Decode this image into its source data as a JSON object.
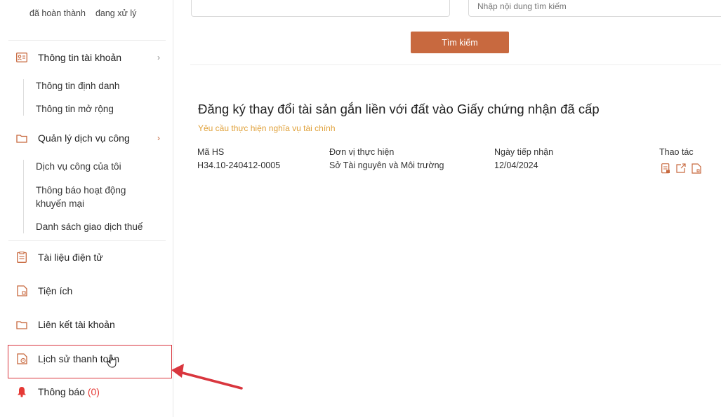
{
  "sidebar": {
    "status_tabs": [
      "đã hoàn thành",
      "đang xử lý"
    ],
    "account": {
      "label": "Thông tin tài khoản",
      "children": [
        "Thông tin định danh",
        "Thông tin mở rộng"
      ]
    },
    "services": {
      "label": "Quản lý dịch vụ công",
      "children": [
        "Dịch vụ công của tôi",
        "Thông báo hoạt động khuyến mại",
        "Danh sách giao dịch thuế"
      ]
    },
    "items": [
      {
        "label": "Tài liệu điện tử",
        "icon": "document-icon"
      },
      {
        "label": "Tiện ích",
        "icon": "utility-icon"
      },
      {
        "label": "Liên kết tài khoản",
        "icon": "folder-link-icon"
      },
      {
        "label": "Lịch sử thanh toán",
        "icon": "payment-history-icon"
      }
    ],
    "notifications": {
      "label": "Thông báo",
      "count": "(0)"
    }
  },
  "search": {
    "button_label": "Tìm kiếm",
    "field2_placeholder": "Nhập nội dung tìm kiếm"
  },
  "record": {
    "title": "Đăng ký thay đổi tài sản gắn liền với đất vào Giấy chứng nhận đã cấp",
    "status": "Yêu cầu thực hiện nghĩa vụ tài chính",
    "columns": {
      "code_header": "Mã HS",
      "unit_header": "Đơn vị thực hiện",
      "date_header": "Ngày tiếp nhận",
      "actions_header": "Thao tác"
    },
    "values": {
      "code": "H34.10-240412-0005",
      "unit": "Sở Tài nguyên và Môi trường",
      "date": "12/04/2024"
    }
  },
  "colors": {
    "accent": "#c8693f",
    "highlight": "#d9363e",
    "status": "#e0a13a",
    "bell": "#e53935"
  }
}
